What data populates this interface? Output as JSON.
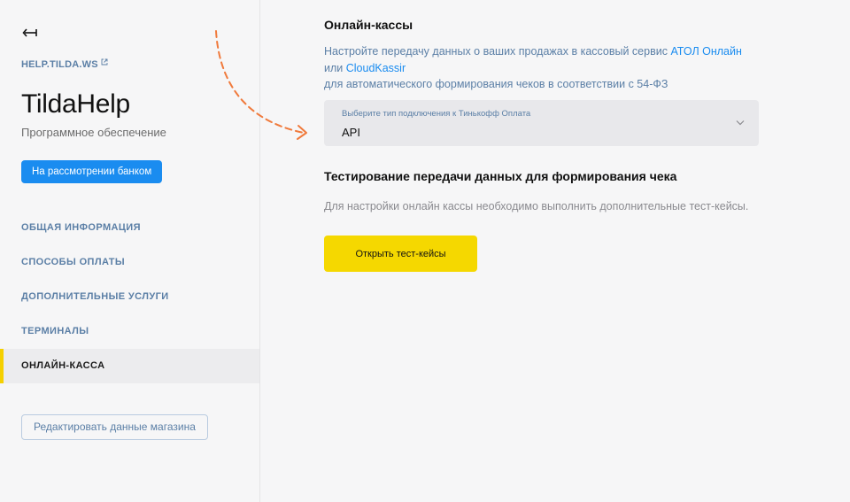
{
  "sidebar": {
    "site_link": "HELP.TILDA.WS",
    "shop_title": "TildaHelp",
    "shop_subtitle": "Программное обеспечение",
    "status_badge": "На рассмотрении банком",
    "nav": [
      {
        "label": "Общая информация",
        "active": false
      },
      {
        "label": "Способы оплаты",
        "active": false
      },
      {
        "label": "Дополнительные услуги",
        "active": false
      },
      {
        "label": "Терминалы",
        "active": false
      },
      {
        "label": "Онлайн-касса",
        "active": true
      }
    ],
    "edit_button": "Редактировать данные магазина"
  },
  "main": {
    "online_kassa": {
      "title": "Онлайн-кассы",
      "desc_prefix": "Настройте передачу данных о ваших продажах в кассовый сервис ",
      "link_atol": "АТОЛ Онлайн",
      "desc_or": "или ",
      "link_cloud": "CloudKassir",
      "desc_suffix": "для автоматического формирования чеков в соответствии с 54-ФЗ"
    },
    "connection_select": {
      "label": "Выберите тип подключения к Тинькофф Оплата",
      "value": "API"
    },
    "testing": {
      "title": "Тестирование передачи данных для формирования чека",
      "desc": "Для настройки онлайн кассы необходимо выполнить дополнительные тест-кейсы.",
      "button": "Открыть тест-кейсы"
    }
  },
  "colors": {
    "accent_blue": "#1a8cf0",
    "accent_yellow": "#f5d800",
    "link_muted": "#5b7fa6",
    "annotation_arrow": "#f07a3c"
  },
  "icons": [
    "back-arrow-icon",
    "external-link-icon",
    "chevron-down-icon"
  ]
}
